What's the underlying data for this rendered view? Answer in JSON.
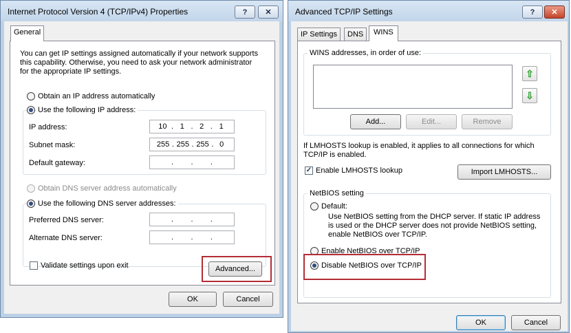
{
  "ipv4": {
    "title": "Internet Protocol Version 4 (TCP/IPv4) Properties",
    "help_glyph": "?",
    "close_glyph": "✕",
    "tab_general": "General",
    "intro": "You can get IP settings assigned automatically if your network supports this capability. Otherwise, you need to ask your network administrator for the appropriate IP settings.",
    "obtain_ip_auto": "Obtain an IP address automatically",
    "use_following_ip": "Use the following IP address:",
    "ip_address_label": "IP address:",
    "ip_address": [
      "10",
      "1",
      "2",
      "1"
    ],
    "subnet_label": "Subnet mask:",
    "subnet": [
      "255",
      "255",
      "255",
      "0"
    ],
    "gateway_label": "Default gateway:",
    "obtain_dns_auto": "Obtain DNS server address automatically",
    "use_following_dns": "Use the following DNS server addresses:",
    "preferred_dns_label": "Preferred DNS server:",
    "alternate_dns_label": "Alternate DNS server:",
    "validate_label": "Validate settings upon exit",
    "advanced_button": "Advanced...",
    "ok_button": "OK",
    "cancel_button": "Cancel"
  },
  "advanced": {
    "title": "Advanced TCP/IP Settings",
    "help_glyph": "?",
    "close_glyph": "✕",
    "tabs": [
      "IP Settings",
      "DNS",
      "WINS"
    ],
    "wins_group_label": "WINS addresses, in order of use:",
    "add_button": "Add...",
    "edit_button": "Edit...",
    "remove_button": "Remove",
    "lmhosts_info": "If LMHOSTS lookup is enabled, it applies to all connections for which TCP/IP is enabled.",
    "enable_lmhosts": "Enable LMHOSTS lookup",
    "import_lmhosts": "Import LMHOSTS...",
    "netbios_group_label": "NetBIOS setting",
    "default_label": "Default:",
    "default_desc": "Use NetBIOS setting from the DHCP server. If static IP address is used or the DHCP server does not provide NetBIOS setting, enable NetBIOS over TCP/IP.",
    "enable_netbios": "Enable NetBIOS over TCP/IP",
    "disable_netbios": "Disable NetBIOS over TCP/IP",
    "ok_button": "OK",
    "cancel_button": "Cancel"
  },
  "colors": {
    "highlight": "#b32c35",
    "titlebar": "#c2d5ea",
    "close_button": "#c5442a"
  }
}
